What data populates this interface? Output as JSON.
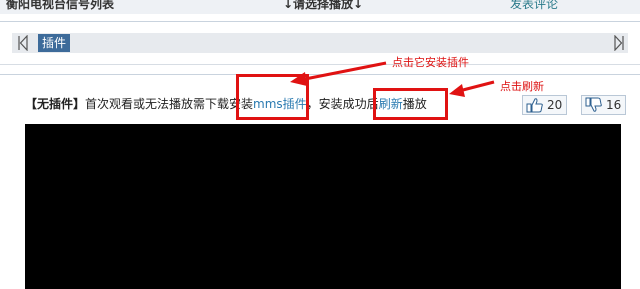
{
  "header": {
    "title": "衡阳电视台信号列表",
    "select_hint": "↓请选择播放↓",
    "comment_link": "发表评论"
  },
  "tabs": {
    "items": [
      "插件"
    ]
  },
  "notice": {
    "tag": "【无插件】",
    "text_before": "首次观看或无法播放需下载安装",
    "plugin_link": "mms插件",
    "text_middle": "，安装成功后",
    "refresh_link": "刷新",
    "text_after": "播放"
  },
  "annotations": {
    "install_hint": "点击它安装插件",
    "refresh_hint": "点击刷新",
    "color": "#e01212"
  },
  "votes": {
    "up_count": "20",
    "down_count": "16",
    "up_icon": "thumbs-up-icon",
    "down_icon": "thumbs-down-icon"
  },
  "player": {
    "background": "#000000"
  }
}
